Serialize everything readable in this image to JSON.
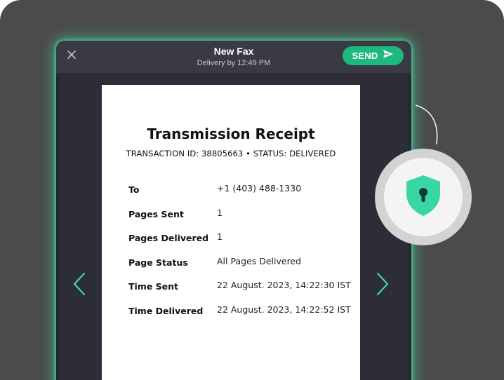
{
  "header": {
    "title": "New Fax",
    "subtitle": "Delivery by 12:49 PM",
    "send_label": "SEND"
  },
  "receipt": {
    "title": "Transmission Receipt",
    "meta": "TRANSACTION ID: 38805663 • STATUS: DELIVERED",
    "fields": [
      {
        "label": "To",
        "value": "+1 (403) 488-1330"
      },
      {
        "label": "Pages Sent",
        "value": "1"
      },
      {
        "label": "Pages Delivered",
        "value": "1"
      },
      {
        "label": "Page Status",
        "value": "All Pages Delivered"
      },
      {
        "label": "Time Sent",
        "value": "22 August. 2023, 14:22:30 IST"
      },
      {
        "label": "Time Delivered",
        "value": "22 August. 2023, 14:22:52 IST"
      }
    ]
  },
  "icons": {
    "close": "close-icon",
    "send": "send-arrow-icon",
    "prev": "chevron-left-icon",
    "next": "chevron-right-icon",
    "security": "shield-lock-icon"
  },
  "colors": {
    "accent": "#1db87e",
    "glow": "#40e8aa",
    "arrow": "#3fd9a6",
    "shield": "#3ad5a5",
    "background": "#4b4b4b",
    "panel": "#2f3039",
    "topbar": "#393a44"
  }
}
